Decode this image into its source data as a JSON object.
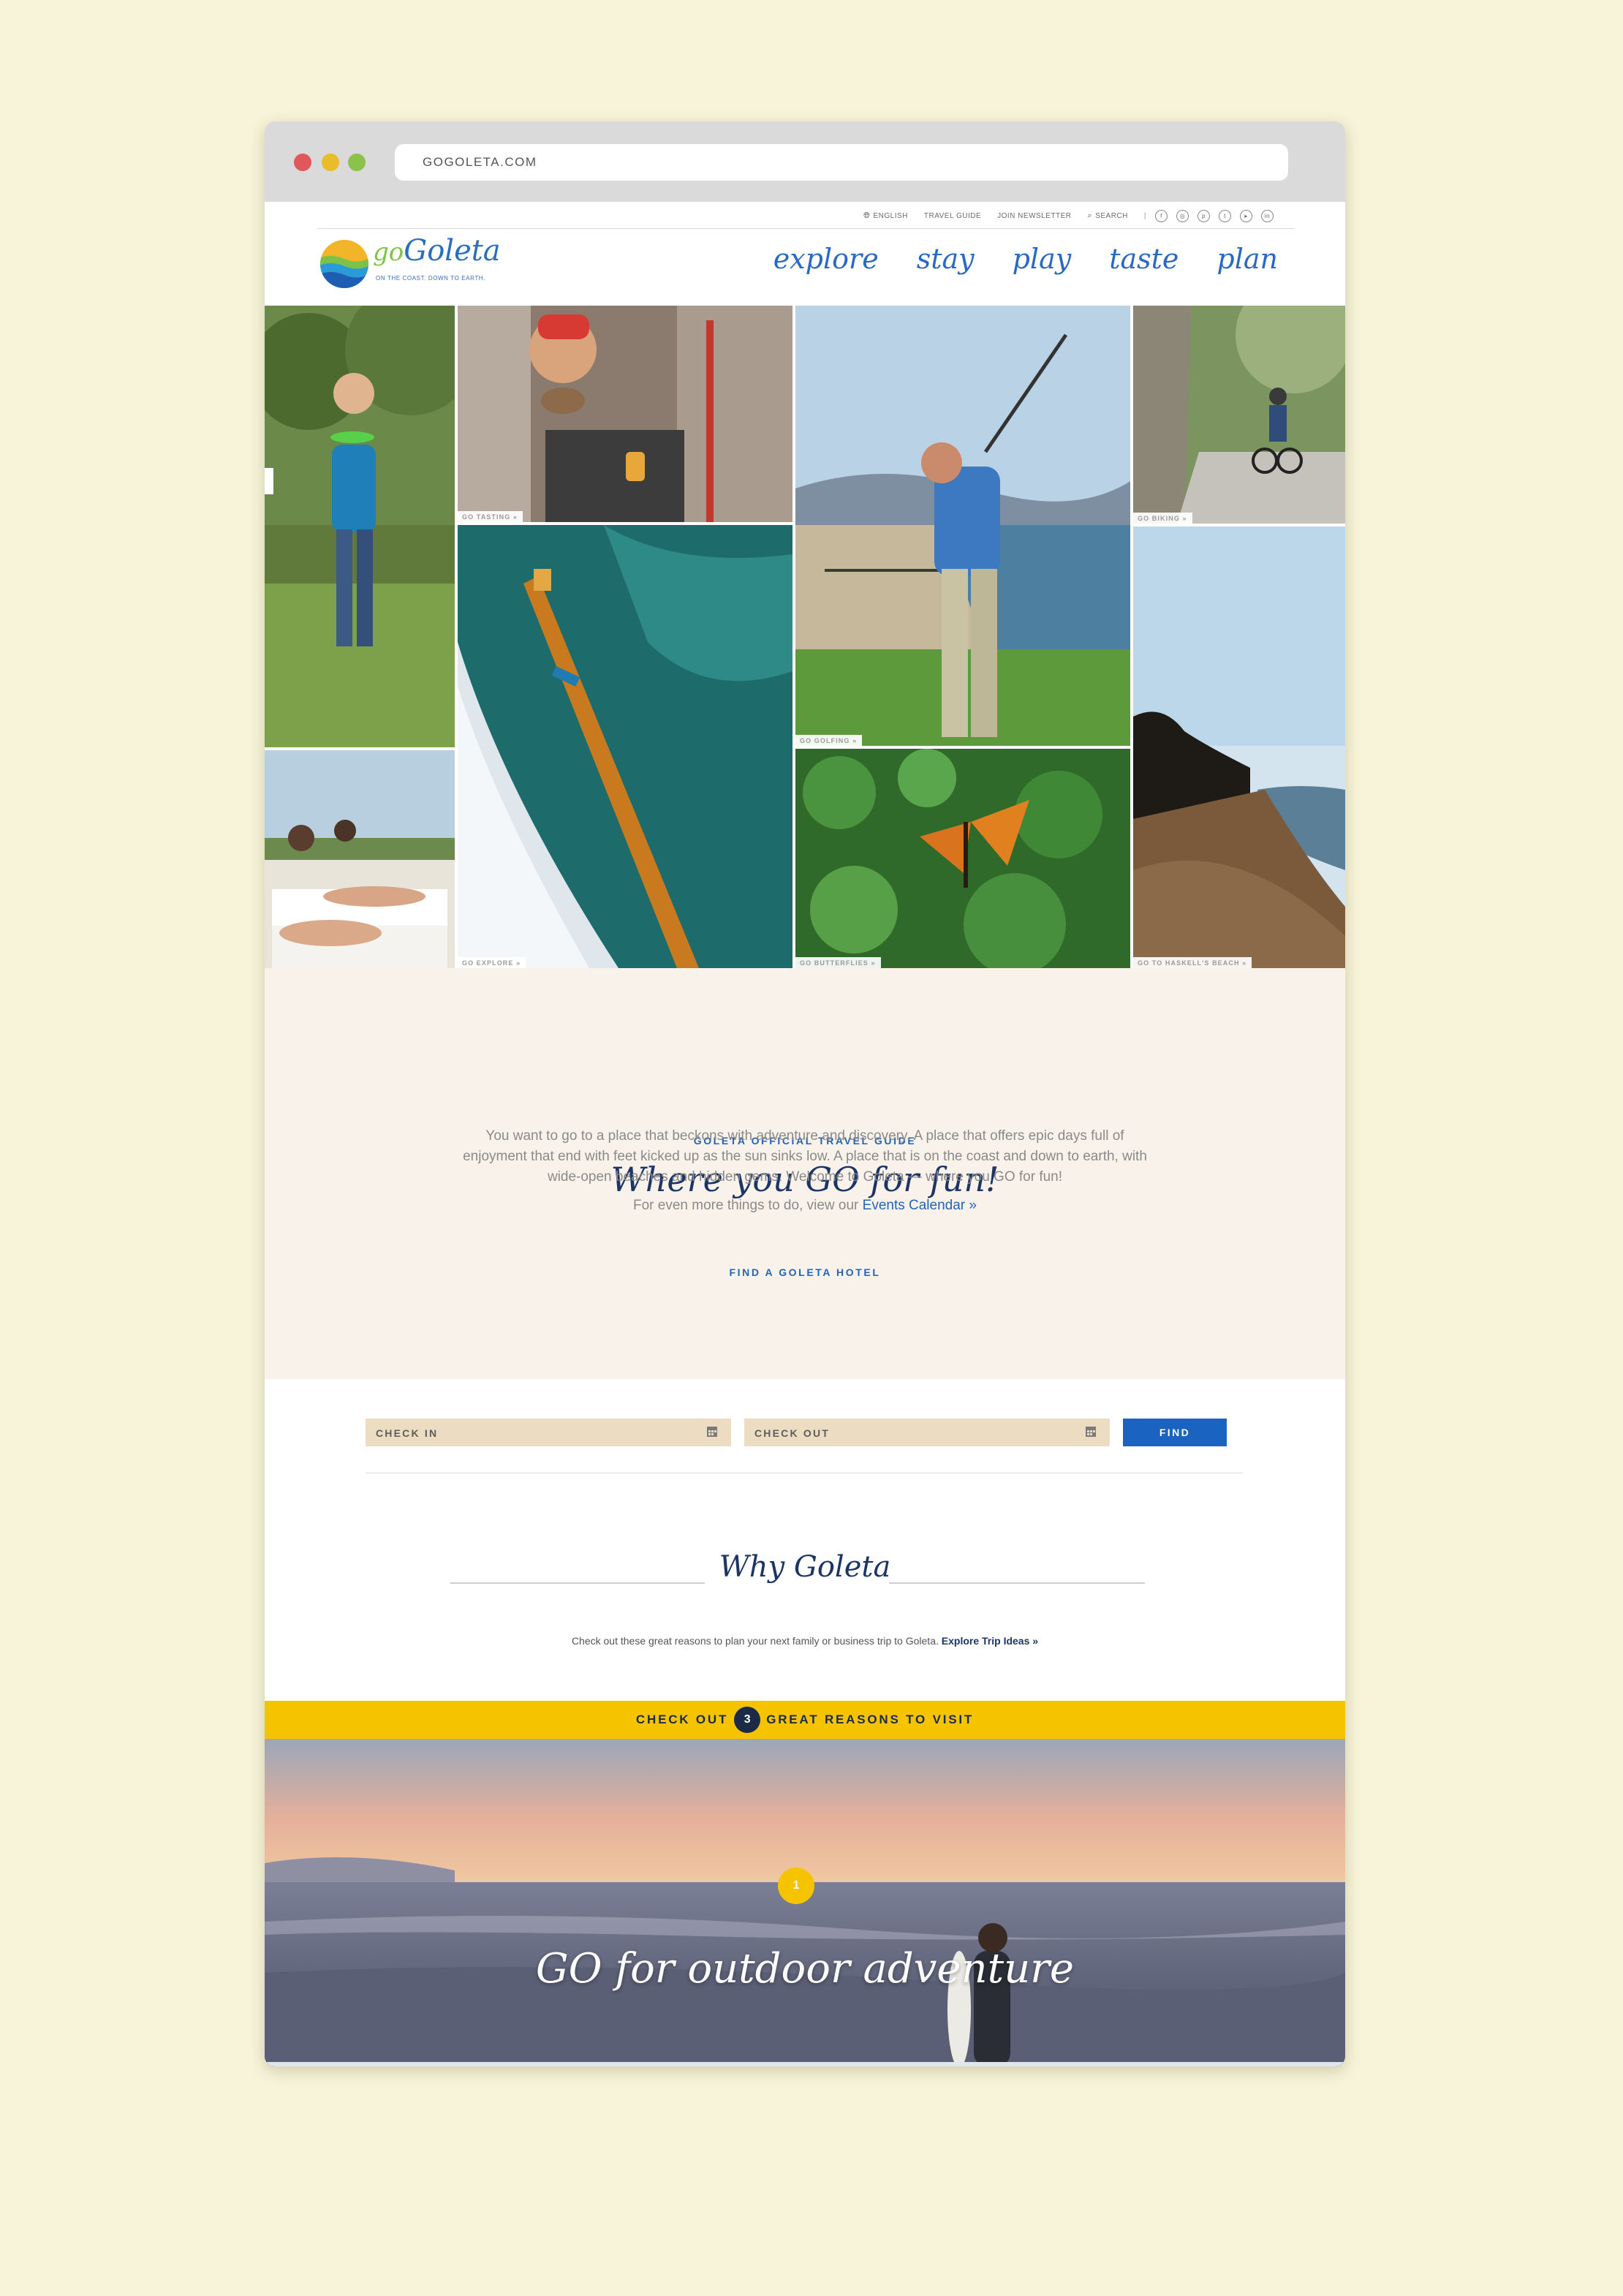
{
  "browser": {
    "url": "GOGOLETA.COM"
  },
  "utility_nav": {
    "language": "ENGLISH",
    "travel_guide": "TRAVEL GUIDE",
    "newsletter": "JOIN NEWSLETTER",
    "search": "SEARCH",
    "separator": "|",
    "social": [
      "facebook-icon",
      "instagram-icon",
      "pinterest-icon",
      "twitter-icon",
      "youtube-icon",
      "linkedin-icon"
    ]
  },
  "logo": {
    "go": "go",
    "name": "Goleta",
    "tagline": "ON THE COAST. DOWN TO EARTH."
  },
  "main_nav": [
    "explore",
    "stay",
    "play",
    "taste",
    "plan"
  ],
  "photo_tags": {
    "tasting": "GO TASTING »",
    "biking": "GO BIKING »",
    "golfing": "GO GOLFING »",
    "explore": "GO EXPLORE »",
    "butterflies": "GO BUTTERFLIES »",
    "haskells": "GO TO HASKELL'S BEACH »"
  },
  "intro": {
    "eyebrow": "GOLETA OFFICIAL TRAVEL GUIDE",
    "title": "Where you GO for fun!",
    "body": "You want to go to a place that beckons with adventure and discovery. A place that offers epic days full of enjoyment that end with feet kicked up as the sun sinks low. A place that is on the coast and down to earth, with wide-open beaches and hidden gems. Welcome to Goleta — where you GO for fun!",
    "more_prefix": "For even more things to do, view our ",
    "more_link": "Events Calendar »"
  },
  "hotel_search": {
    "heading": "FIND A GOLETA HOTEL",
    "check_in": "CHECK IN",
    "check_out": "CHECK OUT",
    "find": "FIND"
  },
  "why": {
    "title": "Why Goleta",
    "desc_prefix": "Check out these great reasons to plan your next family or business trip to Goleta. ",
    "desc_link": "Explore Trip Ideas »"
  },
  "reasons_banner": {
    "before": "CHECK OUT",
    "count": "3",
    "after": "GREAT REASONS TO VISIT"
  },
  "hero": {
    "number": "1",
    "title": "GO for outdoor adventure"
  },
  "colors": {
    "brand_blue": "#2364b8",
    "navy": "#1c3566",
    "accent_yellow": "#f6c300",
    "page_bg": "#f8f4d9"
  }
}
